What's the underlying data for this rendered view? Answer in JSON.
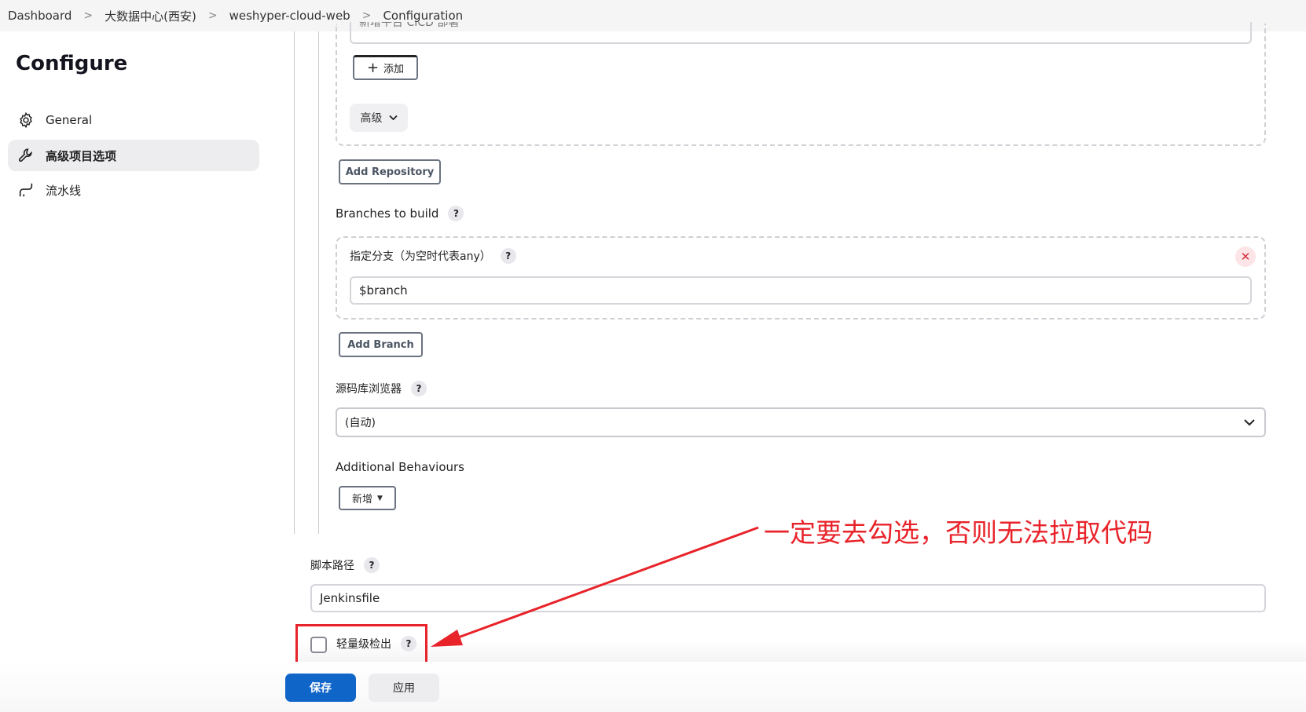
{
  "breadcrumb": [
    "Dashboard",
    "大数据中心(西安)",
    "weshyper-cloud-web",
    "Configuration"
  ],
  "sidebar": {
    "title": "Configure",
    "items": [
      {
        "label": "General",
        "icon": "gear-icon",
        "active": false
      },
      {
        "label": "高级项目选项",
        "icon": "wrench-icon",
        "active": true
      },
      {
        "label": "流水线",
        "icon": "pipeline-icon",
        "active": false
      }
    ]
  },
  "repository": {
    "hidden_select_text": "新增平台 CICD 部署",
    "add_label": "添加",
    "advanced_label": "高级",
    "add_repository_label": "Add Repository"
  },
  "branches": {
    "label": "Branches to build",
    "branch_specifier_label": "指定分支（为空时代表any）",
    "branch_value": "$branch",
    "add_branch_label": "Add Branch"
  },
  "repo_browser": {
    "label": "源码库浏览器",
    "selected": "(自动)"
  },
  "additional_behaviours": {
    "label": "Additional Behaviours",
    "new_label": "新增"
  },
  "script_path": {
    "label": "脚本路径",
    "value": "Jenkinsfile"
  },
  "lightweight_checkout": {
    "label": "轻量级检出",
    "checked": false
  },
  "annotation": "一定要去勾选，否则无法拉取代码",
  "footer": {
    "save_label": "保存",
    "apply_label": "应用"
  },
  "help_symbol": "?",
  "colors": {
    "primary": "#1065c9",
    "annotation_red": "#e8232a"
  }
}
